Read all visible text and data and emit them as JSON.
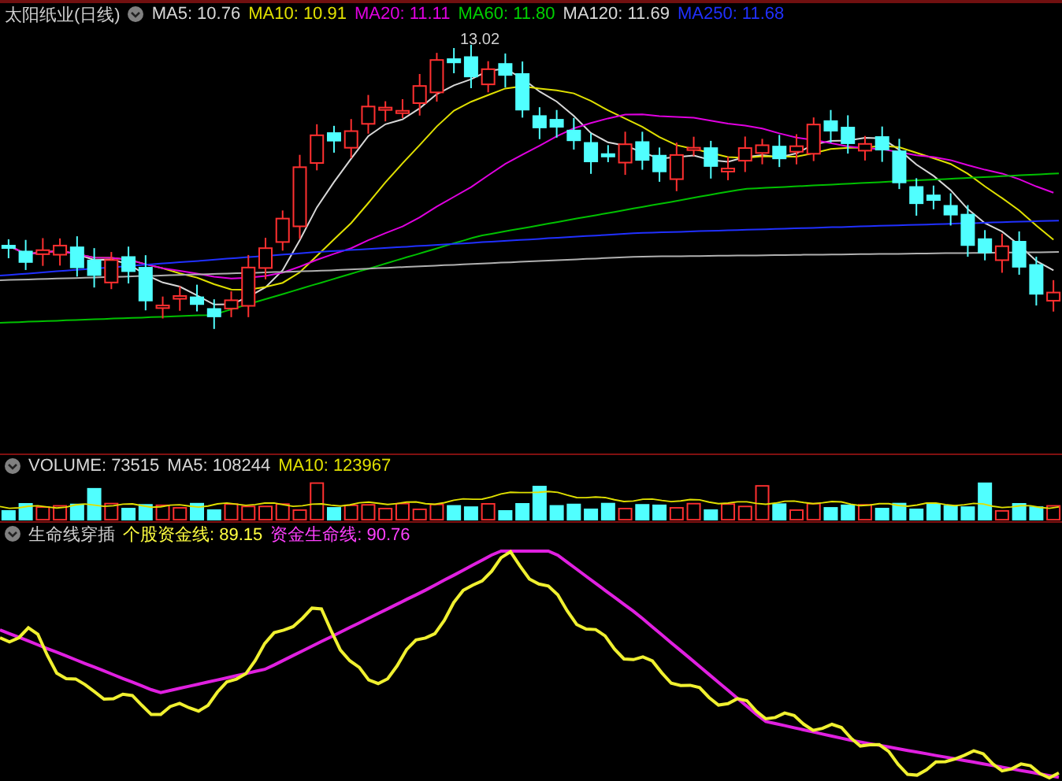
{
  "main_panel": {
    "title": "太阳纸业(日线)",
    "legend": [
      {
        "text": "MA5: 10.76",
        "color": "#d8d8d8"
      },
      {
        "text": "MA10: 10.91",
        "color": "#e0e000"
      },
      {
        "text": "MA20: 11.11",
        "color": "#e000e0"
      },
      {
        "text": "MA60: 11.80",
        "color": "#00d000"
      },
      {
        "text": "MA120: 11.69",
        "color": "#d8d8d8"
      },
      {
        "text": "MA250: 11.68",
        "color": "#2030ff"
      }
    ],
    "annotation": "13.02"
  },
  "volume_panel": {
    "legend": [
      {
        "text": "VOLUME: 73515",
        "color": "#d8d8d8"
      },
      {
        "text": "MA5: 108244",
        "color": "#d8d8d8"
      },
      {
        "text": "MA10: 123967",
        "color": "#e0e000"
      }
    ]
  },
  "indicator_panel": {
    "title": "生命线穿插",
    "legend": [
      {
        "text": "个股资金线: 89.15",
        "color": "#ffff40"
      },
      {
        "text": "资金生命线: 90.76",
        "color": "#ff40ff"
      }
    ]
  }
}
